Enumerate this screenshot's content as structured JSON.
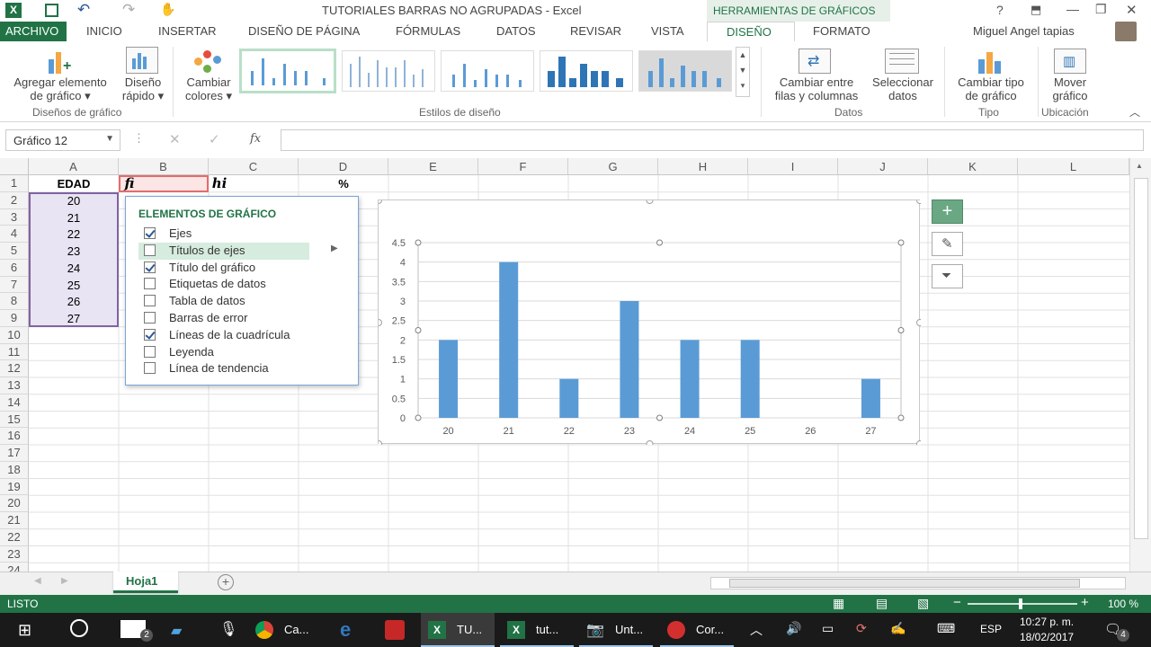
{
  "window": {
    "title": "TUTORIALES BARRAS NO AGRUPADAS - Excel",
    "context_tab": "HERRAMIENTAS DE GRÁFICOS",
    "user": "Miguel Angel tapias"
  },
  "tabs": [
    "ARCHIVO",
    "INICIO",
    "INSERTAR",
    "DISEÑO DE PÁGINA",
    "FÓRMULAS",
    "DATOS",
    "REVISAR",
    "VISTA",
    "DISEÑO",
    "FORMATO"
  ],
  "ribbon": {
    "add_element": [
      "Agregar elemento",
      "de gráfico"
    ],
    "quick_layout": [
      "Diseño",
      "rápido"
    ],
    "change_colors": [
      "Cambiar",
      "colores"
    ],
    "group_layouts": "Diseños de gráfico",
    "group_styles": "Estilos de diseño",
    "switch_rows": [
      "Cambiar entre",
      "filas y columnas"
    ],
    "select_data": [
      "Seleccionar",
      "datos"
    ],
    "group_data": "Datos",
    "change_type": [
      "Cambiar tipo",
      "de gráfico"
    ],
    "group_type": "Tipo",
    "move_chart": [
      "Mover",
      "gráfico"
    ],
    "group_location": "Ubicación"
  },
  "formula": {
    "name_box": "Gráfico 12",
    "fx": "fx",
    "value": ""
  },
  "columns": [
    "A",
    "B",
    "C",
    "D",
    "E",
    "F",
    "G",
    "H",
    "I",
    "J",
    "K",
    "L"
  ],
  "rows": [
    "1",
    "2",
    "3",
    "4",
    "5",
    "6",
    "7",
    "8",
    "9",
    "10",
    "11",
    "12",
    "13",
    "14",
    "15",
    "16",
    "17",
    "18",
    "19",
    "20",
    "21",
    "22",
    "23",
    "24"
  ],
  "cells": {
    "A1": "EDAD",
    "B1": "fi",
    "C1": "hi",
    "D1": "%",
    "A": [
      "20",
      "21",
      "22",
      "23",
      "24",
      "25",
      "26",
      "27"
    ]
  },
  "chart_elements_menu": {
    "title": "ELEMENTOS DE GRÁFICO",
    "items": [
      {
        "label": "Ejes",
        "checked": true
      },
      {
        "label": "Títulos de ejes",
        "checked": false
      },
      {
        "label": "Título del gráfico",
        "checked": true
      },
      {
        "label": "Etiquetas de datos",
        "checked": false
      },
      {
        "label": "Tabla de datos",
        "checked": false
      },
      {
        "label": "Barras de error",
        "checked": false
      },
      {
        "label": "Líneas de la cuadrícula",
        "checked": true
      },
      {
        "label": "Leyenda",
        "checked": false
      },
      {
        "label": "Línea de tendencia",
        "checked": false
      }
    ]
  },
  "chart_data": {
    "type": "bar",
    "categories": [
      "20",
      "21",
      "22",
      "23",
      "24",
      "25",
      "26",
      "27"
    ],
    "values": [
      2,
      4,
      1,
      3,
      2,
      2,
      0,
      1
    ],
    "ylim": [
      0,
      4.5
    ],
    "yticks": [
      "0",
      "0.5",
      "1",
      "1.5",
      "2",
      "2.5",
      "3",
      "3.5",
      "4",
      "4.5"
    ],
    "grid": true,
    "bar_color": "#5b9bd5"
  },
  "sheet": {
    "tab": "Hoja1"
  },
  "status": {
    "text": "LISTO",
    "zoom": "100 %"
  },
  "taskbar": {
    "items": [
      "Ca...",
      "TU...",
      "tut...",
      "Unt...",
      "Cor..."
    ],
    "lang": "ESP",
    "time": "10:27 p. m.",
    "date": "18/02/2017",
    "notif": "4",
    "badge": "2"
  },
  "colors": {
    "excel_green": "#217346",
    "accent": "#2b5797"
  }
}
